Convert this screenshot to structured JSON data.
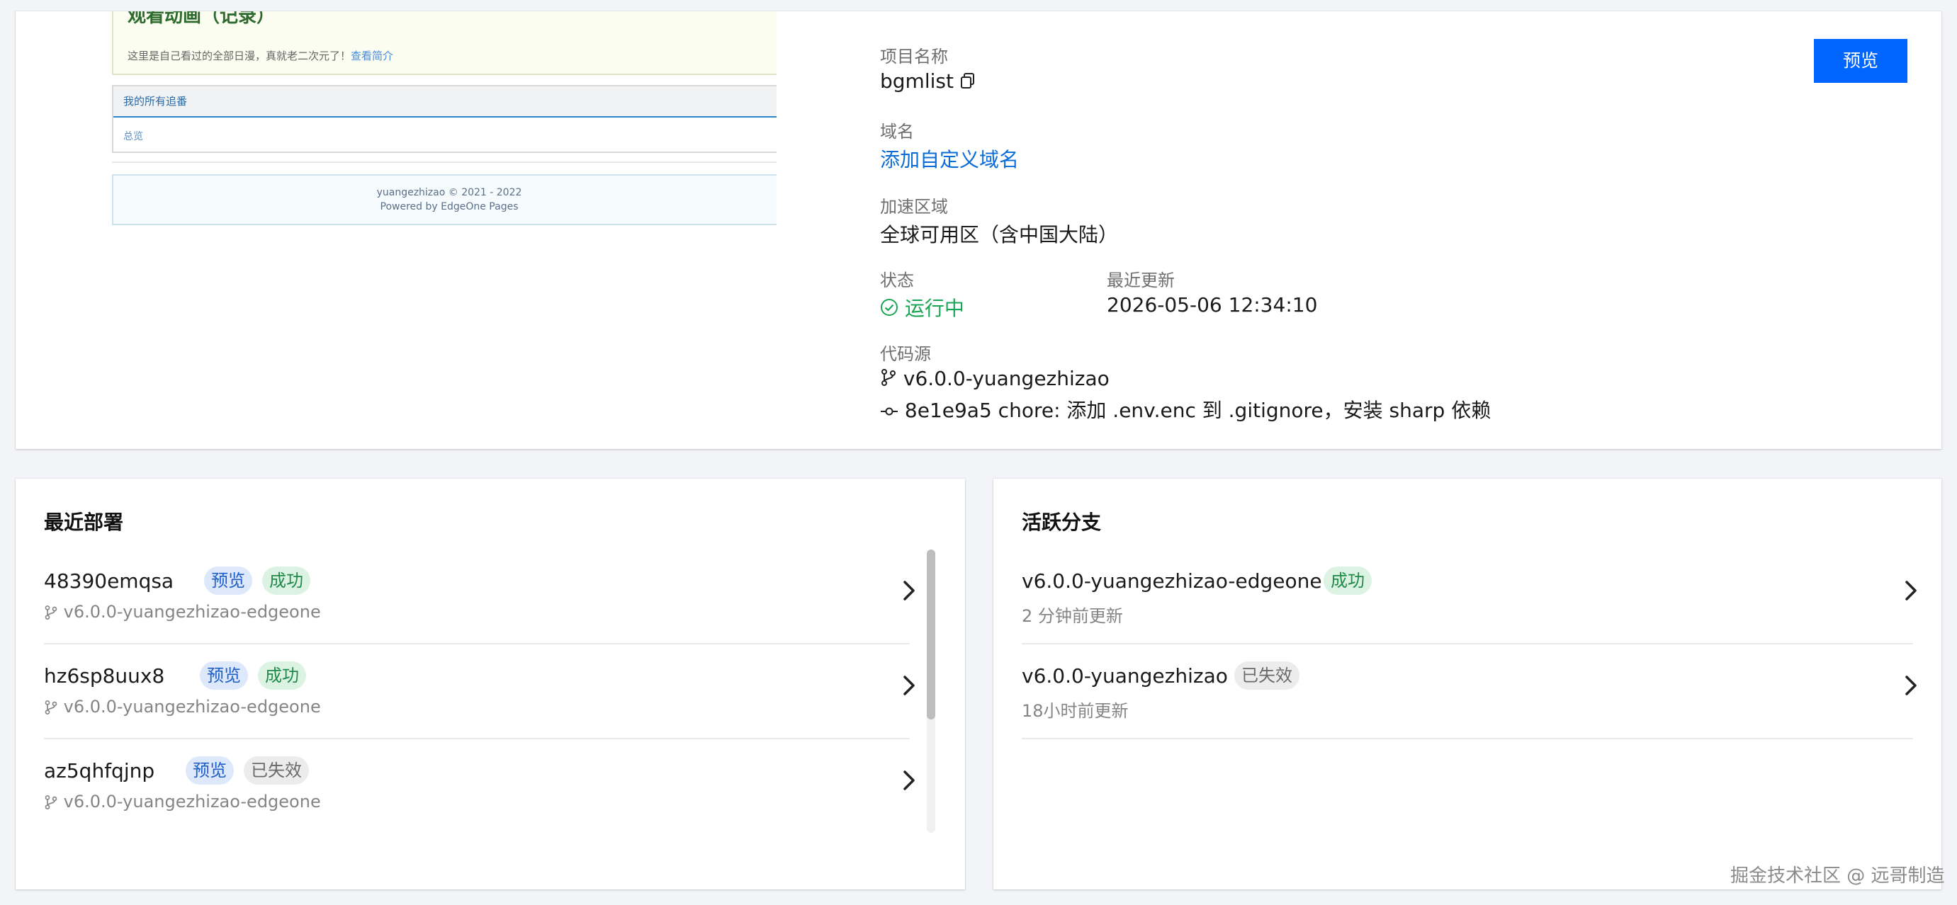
{
  "thumbnail": {
    "intro_title": "观看动画（记录）",
    "intro_text": "这里是自己看过的全部日漫，真就老二次元了！",
    "intro_link": "查看简介",
    "panel_title": "我的所有追番",
    "panel_row": "总览",
    "footer_line1": "yuangezhizao © 2021 - 2022",
    "footer_line2": "Powered by EdgeOne Pages"
  },
  "project": {
    "name_label": "项目名称",
    "name": "bgmlist",
    "domain_label": "域名",
    "domain_link": "添加自定义域名",
    "region_label": "加速区域",
    "region": "全球可用区（含中国大陆）",
    "status_label": "状态",
    "status": "运行中",
    "updated_label": "最近更新",
    "updated": "2026-05-06 12:34:10",
    "source_label": "代码源",
    "branch": "v6.0.0-yuangezhizao",
    "commit": "8e1e9a5 chore: 添加 .env.enc 到 .gitignore，安装 sharp 依赖",
    "preview_button": "预览"
  },
  "deployments": {
    "title": "最近部署",
    "items": [
      {
        "id": "48390emqsa",
        "type": "预览",
        "status": "成功",
        "branch": "v6.0.0-yuangezhizao-edgeone"
      },
      {
        "id": "hz6sp8uux8",
        "type": "预览",
        "status": "成功",
        "branch": "v6.0.0-yuangezhizao-edgeone"
      },
      {
        "id": "az5qhfqjnp",
        "type": "预览",
        "status": "已失效",
        "branch": "v6.0.0-yuangezhizao-edgeone"
      }
    ]
  },
  "branches": {
    "title": "活跃分支",
    "items": [
      {
        "name": "v6.0.0-yuangezhizao-edgeone",
        "status": "成功",
        "updated": "2 分钟前更新"
      },
      {
        "name": "v6.0.0-yuangezhizao",
        "status": "已失效",
        "updated": "18小时前更新"
      }
    ]
  },
  "watermark": "掘金技术社区 @ 远哥制造",
  "colors": {
    "accent": "#0066ff",
    "link": "#0a6cd8",
    "running": "#1aa654",
    "success_bg": "#dcf3e4",
    "preview_bg": "#dde8fb",
    "expired_bg": "#ececec"
  },
  "icons": [
    "copy-icon",
    "check-circle-icon",
    "git-branch-icon",
    "git-commit-icon",
    "chevron-right-icon"
  ]
}
